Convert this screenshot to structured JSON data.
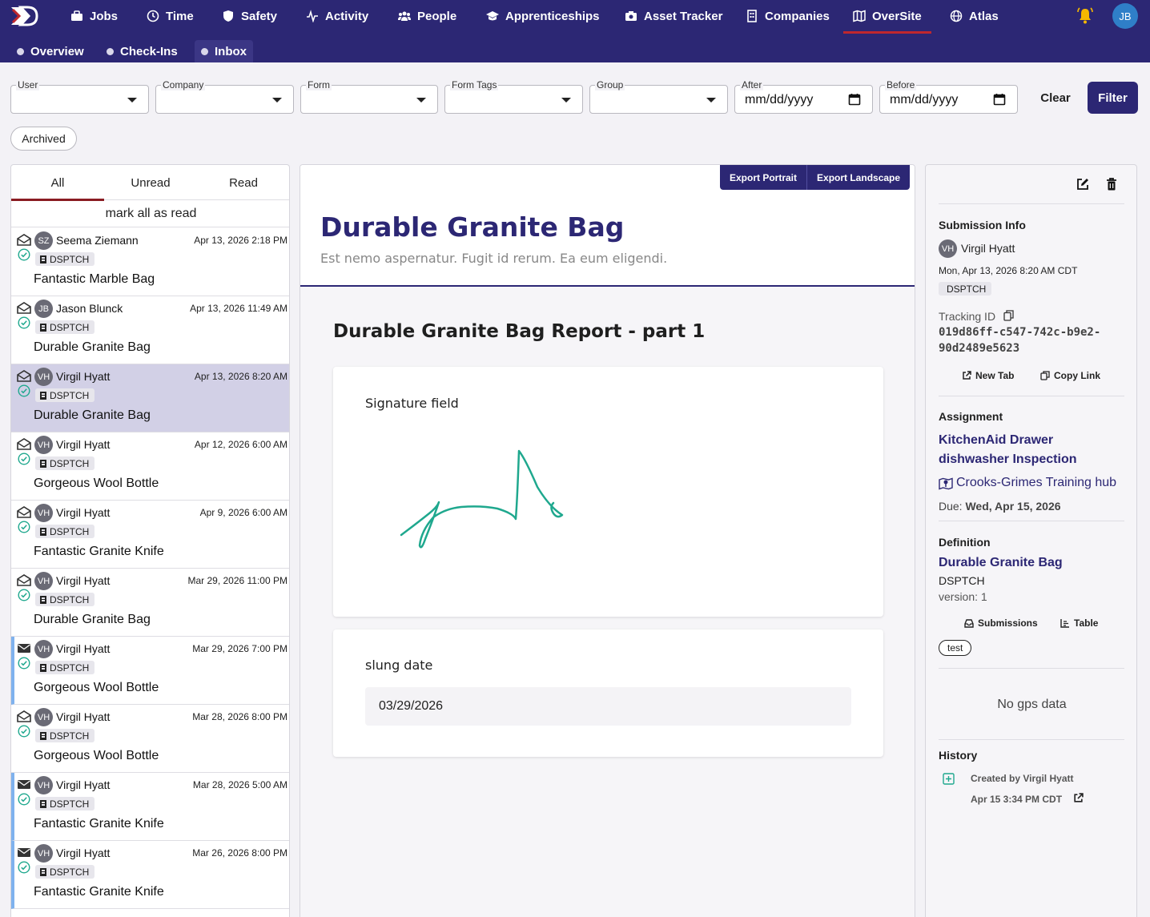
{
  "nav": {
    "items": [
      {
        "label": "Jobs",
        "icon": "briefcase-icon"
      },
      {
        "label": "Time",
        "icon": "clock-icon"
      },
      {
        "label": "Safety",
        "icon": "shield-icon"
      },
      {
        "label": "Activity",
        "icon": "pulse-icon"
      },
      {
        "label": "People",
        "icon": "people-icon"
      },
      {
        "label": "Apprenticeships",
        "icon": "graduation-cap-icon"
      },
      {
        "label": "Asset Tracker",
        "icon": "camera-box-icon"
      },
      {
        "label": "Companies",
        "icon": "building-icon"
      },
      {
        "label": "OverSite",
        "icon": "map-icon"
      },
      {
        "label": "Atlas",
        "icon": "globe-icon"
      }
    ],
    "active": "OverSite",
    "user_initials": "JB",
    "colors": {
      "nav_bg": "#2c2774",
      "active_underline": "#c0272d",
      "bell": "#f5b800"
    }
  },
  "subnav": {
    "items": [
      "Overview",
      "Check-Ins",
      "Inbox"
    ],
    "active": "Inbox"
  },
  "filters": {
    "user": "User",
    "company": "Company",
    "form": "Form",
    "form_tags": "Form Tags",
    "group": "Group",
    "after": "After",
    "before": "Before",
    "date_placeholder": "mm/dd/yyyy",
    "clear": "Clear",
    "filter": "Filter",
    "archived": "Archived"
  },
  "inbox": {
    "tabs": [
      "All",
      "Unread",
      "Read"
    ],
    "active_tab": "All",
    "mark_all": "mark all as read",
    "items": [
      {
        "initials": "SZ",
        "name": "Seema Ziemann",
        "date": "Apr 13, 2026 2:18 PM",
        "tag": "DSPTCH",
        "title": "Fantastic Marble Bag",
        "unread": false,
        "selected": false
      },
      {
        "initials": "JB",
        "name": "Jason Blunck",
        "date": "Apr 13, 2026 11:49 AM",
        "tag": "DSPTCH",
        "title": "Durable Granite Bag",
        "unread": false,
        "selected": false
      },
      {
        "initials": "VH",
        "name": "Virgil Hyatt",
        "date": "Apr 13, 2026 8:20 AM",
        "tag": "DSPTCH",
        "title": "Durable Granite Bag",
        "unread": false,
        "selected": true
      },
      {
        "initials": "VH",
        "name": "Virgil Hyatt",
        "date": "Apr 12, 2026 6:00 AM",
        "tag": "DSPTCH",
        "title": "Gorgeous Wool Bottle",
        "unread": false,
        "selected": false
      },
      {
        "initials": "VH",
        "name": "Virgil Hyatt",
        "date": "Apr 9, 2026 6:00 AM",
        "tag": "DSPTCH",
        "title": "Fantastic Granite Knife",
        "unread": false,
        "selected": false
      },
      {
        "initials": "VH",
        "name": "Virgil Hyatt",
        "date": "Mar 29, 2026 11:00 PM",
        "tag": "DSPTCH",
        "title": "Durable Granite Bag",
        "unread": false,
        "selected": false
      },
      {
        "initials": "VH",
        "name": "Virgil Hyatt",
        "date": "Mar 29, 2026 7:00 PM",
        "tag": "DSPTCH",
        "title": "Gorgeous Wool Bottle",
        "unread": true,
        "selected": false
      },
      {
        "initials": "VH",
        "name": "Virgil Hyatt",
        "date": "Mar 28, 2026 8:00 PM",
        "tag": "DSPTCH",
        "title": "Gorgeous Wool Bottle",
        "unread": false,
        "selected": false
      },
      {
        "initials": "VH",
        "name": "Virgil Hyatt",
        "date": "Mar 28, 2026 5:00 AM",
        "tag": "DSPTCH",
        "title": "Fantastic Granite Knife",
        "unread": true,
        "selected": false
      },
      {
        "initials": "VH",
        "name": "Virgil Hyatt",
        "date": "Mar 26, 2026 8:00 PM",
        "tag": "DSPTCH",
        "title": "Fantastic Granite Knife",
        "unread": true,
        "selected": false
      }
    ]
  },
  "document": {
    "export_portrait": "Export Portrait",
    "export_landscape": "Export Landscape",
    "title": "Durable Granite Bag",
    "subtitle": "Est nemo aspernatur. Fugit id rerum. Ea eum eligendi.",
    "report_title": "Durable Granite Bag Report - part 1",
    "signature_label": "Signature field",
    "signature_color": "#1fa88e",
    "date_label": "slung date",
    "date_value": "03/29/2026"
  },
  "details": {
    "submission_info": "Submission Info",
    "submitter_initials": "VH",
    "submitter": "Virgil Hyatt",
    "submitted_at": "Mon, Apr 13, 2026 8:20 AM CDT",
    "tag": "DSPTCH",
    "tracking_label": "Tracking ID",
    "tracking_id_1": "019d86ff-c547-742c-b9e2-",
    "tracking_id_2": "90d2489e5623",
    "new_tab": "New Tab",
    "copy_link": "Copy Link",
    "assignment": "Assignment",
    "assignment_link_1": "KitchenAid Drawer",
    "assignment_link_2": "dishwasher Inspection",
    "location": "Crooks-Grimes Training hub",
    "due_label": "Due:",
    "due_value": "Wed, Apr 15, 2026",
    "definition": "Definition",
    "definition_link": "Durable Granite Bag",
    "definition_code": "DSPTCH",
    "version": "version: 1",
    "submissions": "Submissions",
    "table": "Table",
    "chip": "test",
    "gps": "No gps data",
    "history": "History",
    "history_created": "Created by Virgil Hyatt",
    "history_time": "Apr 15 3:34 PM CDT"
  }
}
